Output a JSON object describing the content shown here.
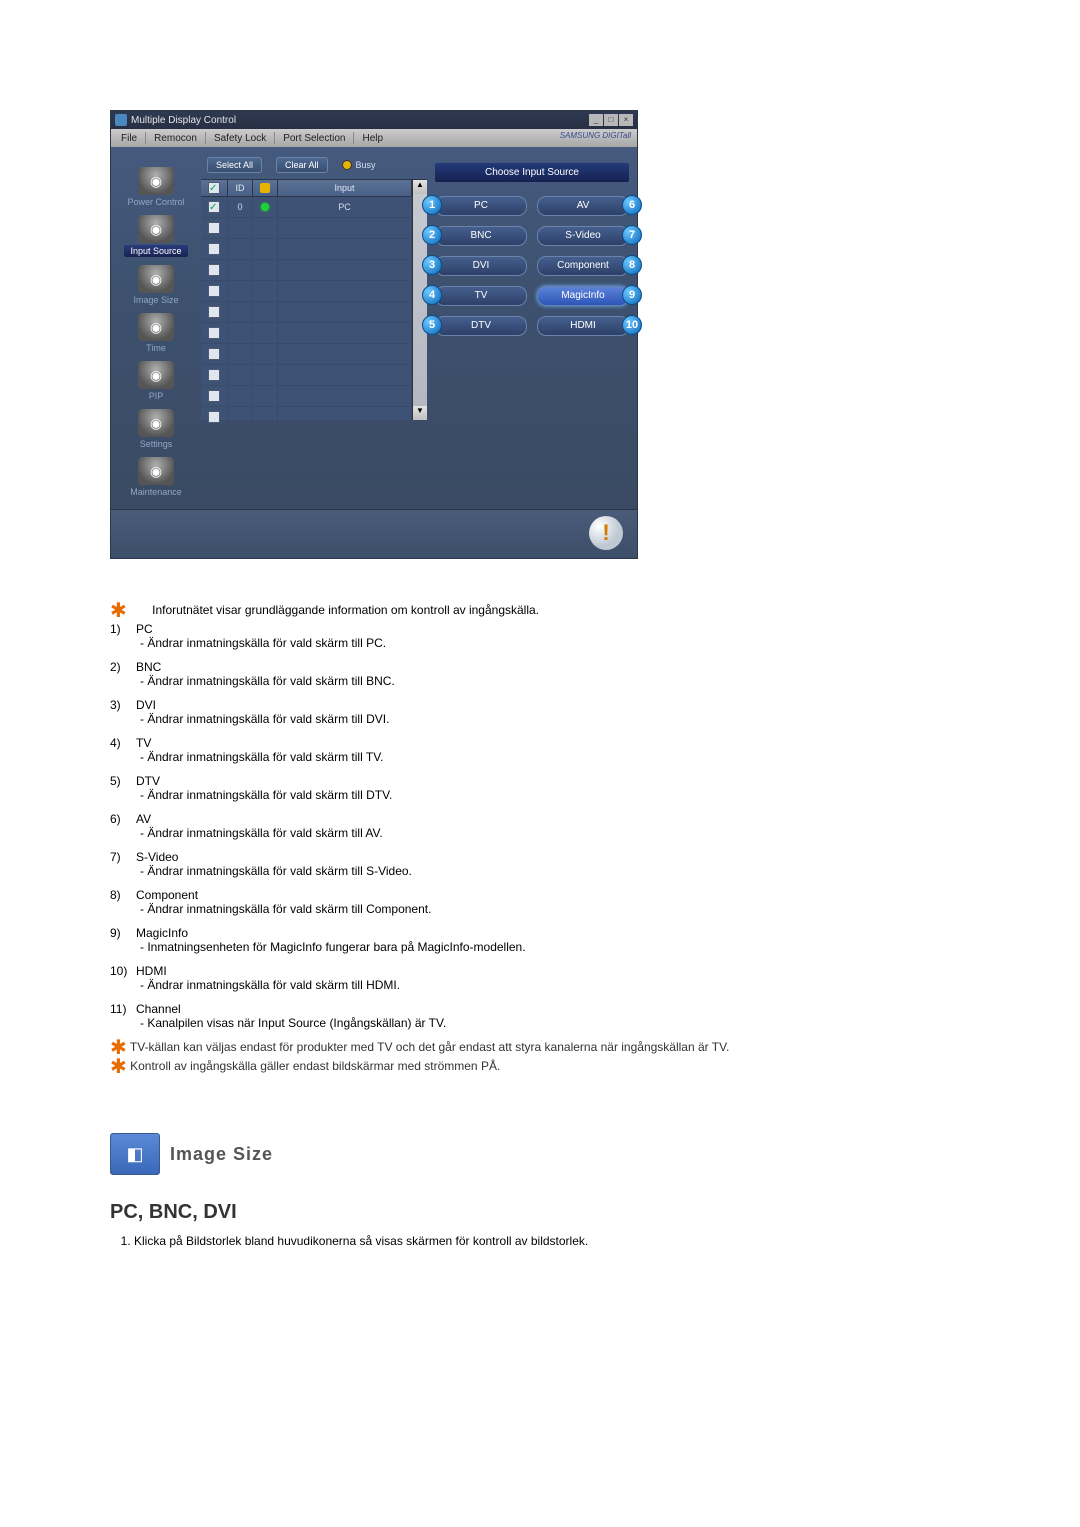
{
  "window": {
    "title": "Multiple Display Control",
    "menubar": [
      "File",
      "Remocon",
      "Safety Lock",
      "Port Selection",
      "Help"
    ],
    "brand": "SAMSUNG DIGITall"
  },
  "topControls": {
    "selectAll": "Select All",
    "clearAll": "Clear All",
    "busy": "Busy"
  },
  "sidenav": [
    {
      "label": "Power Control",
      "active": false
    },
    {
      "label": "Input Source",
      "active": true
    },
    {
      "label": "Image Size",
      "active": false
    },
    {
      "label": "Time",
      "active": false
    },
    {
      "label": "PIP",
      "active": false
    },
    {
      "label": "Settings",
      "active": false
    },
    {
      "label": "Maintenance",
      "active": false
    }
  ],
  "grid": {
    "headers": {
      "check": "✓",
      "id": "ID",
      "power": "",
      "input": "Input"
    },
    "rows": [
      {
        "checked": true,
        "id": "0",
        "powerOn": true,
        "input": "PC"
      },
      {
        "checked": false,
        "id": "",
        "powerOn": false,
        "input": ""
      },
      {
        "checked": false,
        "id": "",
        "powerOn": false,
        "input": ""
      },
      {
        "checked": false,
        "id": "",
        "powerOn": false,
        "input": ""
      },
      {
        "checked": false,
        "id": "",
        "powerOn": false,
        "input": ""
      },
      {
        "checked": false,
        "id": "",
        "powerOn": false,
        "input": ""
      },
      {
        "checked": false,
        "id": "",
        "powerOn": false,
        "input": ""
      },
      {
        "checked": false,
        "id": "",
        "powerOn": false,
        "input": ""
      },
      {
        "checked": false,
        "id": "",
        "powerOn": false,
        "input": ""
      },
      {
        "checked": false,
        "id": "",
        "powerOn": false,
        "input": ""
      },
      {
        "checked": false,
        "id": "",
        "powerOn": false,
        "input": ""
      }
    ]
  },
  "rightPanel": {
    "title": "Choose Input Source",
    "left": [
      {
        "n": "1",
        "label": "PC"
      },
      {
        "n": "2",
        "label": "BNC"
      },
      {
        "n": "3",
        "label": "DVI"
      },
      {
        "n": "4",
        "label": "TV"
      },
      {
        "n": "5",
        "label": "DTV"
      }
    ],
    "right": [
      {
        "n": "6",
        "label": "AV"
      },
      {
        "n": "7",
        "label": "S-Video"
      },
      {
        "n": "8",
        "label": "Component"
      },
      {
        "n": "9",
        "label": "MagicInfo",
        "hl": true
      },
      {
        "n": "10",
        "label": "HDMI"
      }
    ]
  },
  "text": {
    "intro": "Inforutnätet visar grundläggande information om kontroll av ingångskälla.",
    "items": [
      {
        "n": "1)",
        "t": "PC",
        "d": "- Ändrar inmatningskälla för vald skärm till PC."
      },
      {
        "n": "2)",
        "t": "BNC",
        "d": "- Ändrar inmatningskälla för vald skärm till BNC."
      },
      {
        "n": "3)",
        "t": "DVI",
        "d": "- Ändrar inmatningskälla för vald skärm till DVI."
      },
      {
        "n": "4)",
        "t": "TV",
        "d": "- Ändrar inmatningskälla för vald skärm till TV."
      },
      {
        "n": "5)",
        "t": "DTV",
        "d": "- Ändrar inmatningskälla för vald skärm till DTV."
      },
      {
        "n": "6)",
        "t": "AV",
        "d": "- Ändrar inmatningskälla för vald skärm till AV."
      },
      {
        "n": "7)",
        "t": "S-Video",
        "d": "- Ändrar inmatningskälla för vald skärm till S-Video."
      },
      {
        "n": "8)",
        "t": "Component",
        "d": "- Ändrar inmatningskälla för vald skärm till Component."
      },
      {
        "n": "9)",
        "t": "MagicInfo",
        "d": "- Inmatningsenheten för MagicInfo fungerar bara på MagicInfo-modellen."
      },
      {
        "n": "10)",
        "t": "HDMI",
        "d": "- Ändrar inmatningskälla för vald skärm till HDMI."
      },
      {
        "n": "11)",
        "t": "Channel",
        "d": "- Kanalpilen visas när Input Source (Ingångskällan) är TV."
      }
    ],
    "note1": "TV-källan kan väljas endast för produkter med TV och det går endast att styra kanalerna när ingångskällan är TV.",
    "note2": "Kontroll av ingångskälla gäller endast bildskärmar med strömmen PÅ.",
    "section": "Image Size",
    "sub": "PC, BNC, DVI",
    "step1": "Klicka på Bildstorlek bland huvudikonerna så visas skärmen för kontroll av bildstorlek."
  }
}
